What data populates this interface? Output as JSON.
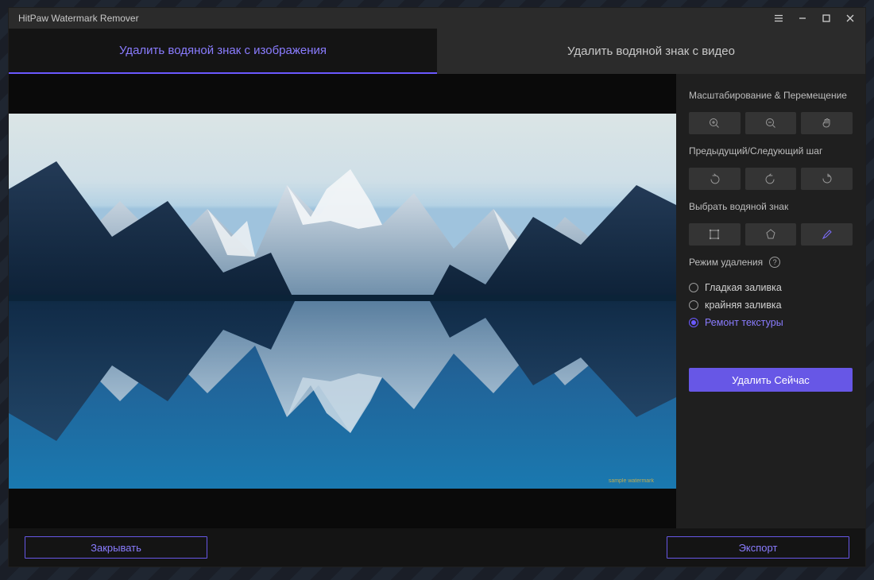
{
  "app": {
    "title": "HitPaw Watermark Remover"
  },
  "tabs": {
    "image": "Удалить водяной знак с изображения",
    "video": "Удалить водяной знак с видео"
  },
  "sidebar": {
    "zoom_pan_label": "Масштабирование & Перемещение",
    "undo_redo_label": "Предыдущий/Следующий шаг",
    "select_wm_label": "Выбрать водяной знак",
    "remove_mode_label": "Режим удаления",
    "modes": {
      "smooth": "Гладкая заливка",
      "edge": "крайняя заливка",
      "texture": "Ремонт текстуры"
    },
    "remove_now": "Удалить Сейчас"
  },
  "footer": {
    "close": "Закрывать",
    "export": "Экспорт"
  },
  "colors": {
    "accent": "#6b59ff",
    "accent_fill": "#6757e6",
    "panel": "#1f1f1f",
    "canvas": "#0a0a0a"
  }
}
